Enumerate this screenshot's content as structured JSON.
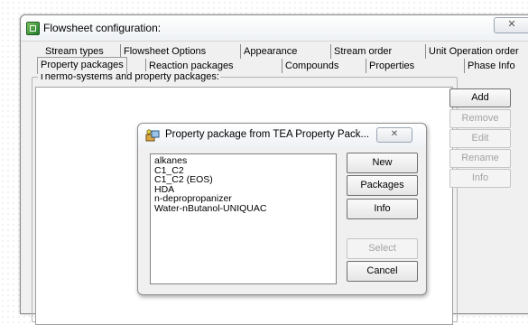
{
  "window": {
    "title": "Flowsheet configuration:",
    "close_label": "✕"
  },
  "tabs_row1": [
    {
      "label": "Stream types"
    },
    {
      "label": "Flowsheet Options"
    },
    {
      "label": "Appearance"
    },
    {
      "label": "Stream order"
    },
    {
      "label": "Unit Operation order"
    }
  ],
  "tabs_row2": [
    {
      "label": "Property packages",
      "active": true
    },
    {
      "label": "Reaction packages"
    },
    {
      "label": "Compounds"
    },
    {
      "label": "Properties"
    },
    {
      "label": "Phase Info"
    }
  ],
  "group": {
    "label": "Thermo-systems and property packages:"
  },
  "side_buttons": [
    {
      "label": "Add",
      "enabled": true
    },
    {
      "label": "Remove",
      "enabled": false
    },
    {
      "label": "Edit",
      "enabled": false
    },
    {
      "label": "Rename",
      "enabled": false
    },
    {
      "label": "Info",
      "enabled": false
    }
  ],
  "dialog": {
    "title": "Property package from TEA Property Pack...",
    "close_label": "✕",
    "items": [
      "alkanes",
      "C1_C2",
      "C1_C2 (EOS)",
      "HDA",
      "n-depropropanizer",
      "Water-nButanol-UNIQUAC"
    ],
    "buttons": [
      {
        "label": "New",
        "enabled": true
      },
      {
        "label": "Packages",
        "enabled": true
      },
      {
        "label": "Info",
        "enabled": true
      },
      {
        "label": "Select",
        "enabled": false
      },
      {
        "label": "Cancel",
        "enabled": true
      }
    ]
  }
}
